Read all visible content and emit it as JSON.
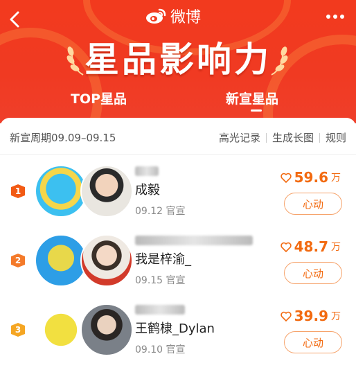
{
  "header": {
    "brand_name": "微博",
    "title": "星品影响力",
    "tabs": [
      {
        "label": "TOP星品",
        "active": false
      },
      {
        "label": "新宣星品",
        "active": true
      }
    ]
  },
  "subbar": {
    "period": "新宣周期09.09–09.15",
    "links": [
      "高光记录",
      "生成长图",
      "规则"
    ]
  },
  "list": [
    {
      "rank": "1",
      "name": "成毅",
      "date": "09.12 官宣",
      "heat": "59.6",
      "unit": "万",
      "button": "心动"
    },
    {
      "rank": "2",
      "name": "我是梓渝_",
      "date": "09.15 官宣",
      "heat": "48.7",
      "unit": "万",
      "button": "心动"
    },
    {
      "rank": "3",
      "name": "王鹤棣_Dylan",
      "date": "09.10 官宣",
      "heat": "39.9",
      "unit": "万",
      "button": "心动"
    }
  ],
  "colors": {
    "header_red": "#f23a1e",
    "accent_orange": "#f26a10",
    "rank_badge": "#f25a14"
  },
  "icons": [
    "back-arrow-icon",
    "more-icon",
    "weibo-logo-icon",
    "heart-icon",
    "laurel-icon"
  ]
}
